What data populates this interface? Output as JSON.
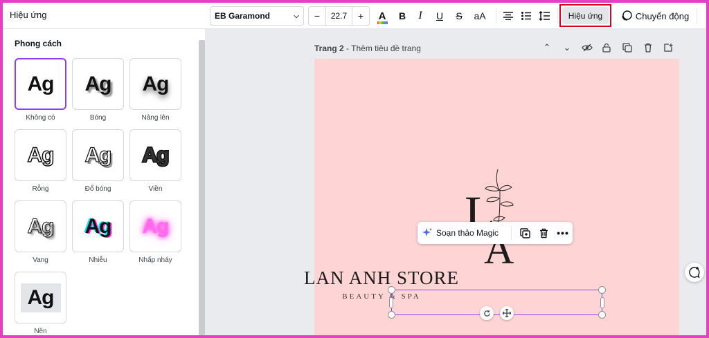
{
  "panel": {
    "title": "Hiệu ứng",
    "section_label": "Phong cách",
    "sample_text": "Ag",
    "styles": [
      {
        "label": "Không có"
      },
      {
        "label": "Bóng"
      },
      {
        "label": "Nâng lên"
      },
      {
        "label": "Rỗng"
      },
      {
        "label": "Đổ bóng"
      },
      {
        "label": "Viền"
      },
      {
        "label": "Vang"
      },
      {
        "label": "Nhiễu"
      },
      {
        "label": "Nhấp nháy"
      },
      {
        "label": "Nền"
      }
    ]
  },
  "toolbar": {
    "font_name": "EB Garamond",
    "font_size": "22.7",
    "minus": "−",
    "plus": "+",
    "bold": "B",
    "italic": "I",
    "underline": "U",
    "strike": "S",
    "case": "aA",
    "effects_label": "Hiệu ứng",
    "animate_label": "Chuyển động"
  },
  "canvas": {
    "page_label": "Trang 2",
    "page_separator": " - ",
    "page_title_placeholder": "Thêm tiêu đề trang",
    "brand_text": "LAN ANH STORE",
    "tagline_text": "BEAUTY & SPA",
    "context_menu": {
      "magic_label": "Soạn thảo Magic"
    }
  },
  "colors": {
    "accent": "#8b3dff",
    "frame": "#e53fc4",
    "highlight": "#e0001b",
    "page_bg": "#ffd4d4"
  }
}
